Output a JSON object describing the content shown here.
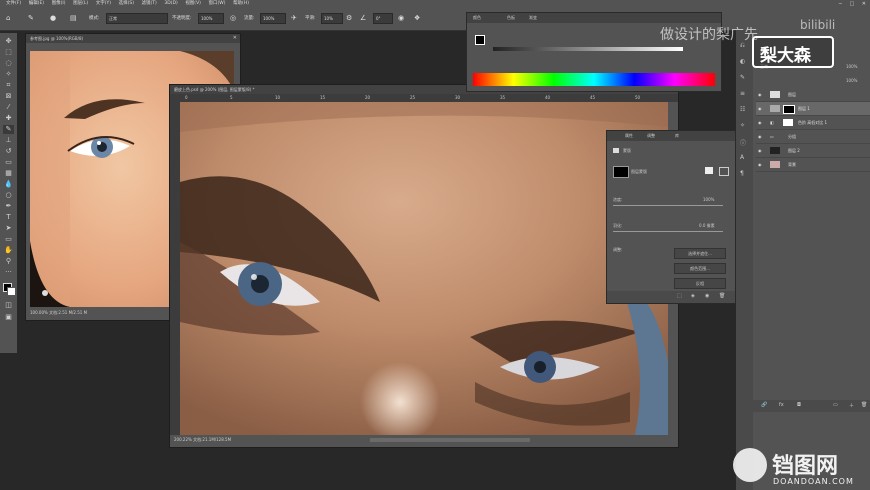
{
  "menu": [
    "文件(F)",
    "编辑(E)",
    "图像(I)",
    "图层(L)",
    "文字(Y)",
    "选择(S)",
    "滤镜(T)",
    "3D(D)",
    "视图(V)",
    "窗口(W)",
    "帮助(H)"
  ],
  "options": {
    "mode_label": "模式:",
    "mode_value": "正常",
    "opacity_label": "不透明度:",
    "opacity_value": "100%",
    "flow_label": "流量:",
    "flow_value": "100%",
    "smooth_label": "平滑:",
    "smooth_value": "10%",
    "angle_value": "0°"
  },
  "doc_left": {
    "title": "参考图.jpg @ 100%(RGB/8)",
    "status": "100.00%  文档:2.51 M/2.51 M"
  },
  "doc_main": {
    "title": "磨皮上色.psd @ 200% (图层, 图层蒙版/8) *",
    "status": "200.22%  文档:21.1M/128.5M",
    "ruler_marks": [
      "0",
      "5",
      "10",
      "15",
      "20",
      "25",
      "30",
      "35",
      "40",
      "45",
      "50"
    ]
  },
  "color_panel": {
    "tabs": [
      "颜色",
      "色板",
      "渐变"
    ]
  },
  "props": {
    "tabs": [
      "属性",
      "调整",
      "库"
    ],
    "mask_label": "蒙版",
    "layer_mask": "图层蒙版",
    "density_label": "浓度:",
    "density_value": "100%",
    "feather_label": "羽化:",
    "feather_value": "0.0 像素",
    "refine_label": "调整:",
    "btn_select": "选择并遮住...",
    "btn_color_range": "颜色范围...",
    "btn_invert": "反相"
  },
  "layers": {
    "kind": "类型",
    "mode": "正常",
    "opacity": "100%",
    "fill": "100%",
    "rows": [
      "图层",
      "图层 1",
      "色阶 高低对比 1",
      "分组",
      "图层 2",
      "背景"
    ]
  },
  "watermark": {
    "text_top": "做设计的梨广先",
    "logo": "梨大森",
    "site": "铛图网",
    "site_sub": "DOANDOAN.COM",
    "bili": "bilibili"
  }
}
